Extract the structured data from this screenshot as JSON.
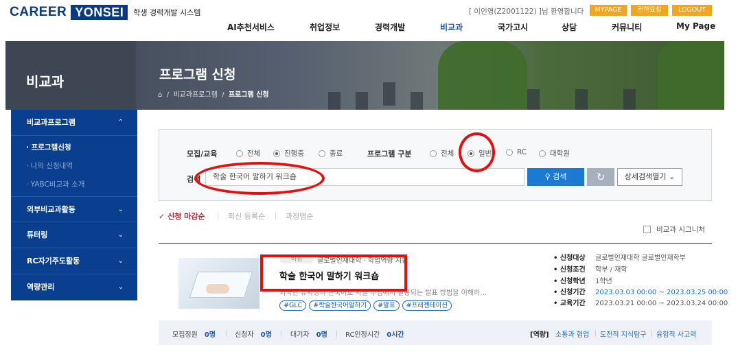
{
  "header": {
    "logo_career": "CAREER",
    "logo_yonsei": "YONSEI",
    "system_name": "학생 경력개발 시스템",
    "welcome": "[ 이인영(Z2001122) ]님 환영합니다",
    "top_buttons": [
      "MYPAGE",
      "권한요청",
      "LOGOUT"
    ],
    "nav": [
      "AI추천서비스",
      "취업정보",
      "경력개발",
      "비교과",
      "국가고시",
      "상담",
      "커뮤니티",
      "My Page"
    ],
    "active_nav": "비교과"
  },
  "banner": {
    "side_title": "비교과",
    "page_title": "프로그램 신청",
    "breadcrumb": [
      "비교과프로그램",
      "프로그램 신청"
    ]
  },
  "sidebar": {
    "groups": [
      {
        "label": "비교과프로그램",
        "chevron": "^"
      },
      {
        "label": "외부비교과활동",
        "chevron": "v"
      },
      {
        "label": "튜터링",
        "chevron": "v"
      },
      {
        "label": "RC자기주도활동",
        "chevron": "v"
      },
      {
        "label": "역량관리",
        "chevron": "v"
      }
    ],
    "subitems": [
      "· 프로그램신청",
      "· 나의 신청내역",
      "· YABC비교과 소개"
    ]
  },
  "search": {
    "recruit_label": "모집/교육",
    "recruit_options": [
      "전체",
      "진행중",
      "종료"
    ],
    "recruit_selected": "진행중",
    "type_label": "프로그램 구분",
    "type_options": [
      "전체",
      "일반",
      "RC",
      "대학원"
    ],
    "type_selected": "일반",
    "search_label": "검색",
    "search_value": "학술 한국어 말하기 워크숍",
    "search_button": "검색",
    "detail_button": "상세검색열기"
  },
  "sort": {
    "options": [
      "신청 마감순",
      "최신 등록순",
      "과정명순"
    ],
    "active": "신청 마감순",
    "signature_label": "비교과 시그니처"
  },
  "program": {
    "tag": "비임",
    "meta": "글로벌인재대학 · 학업역량 지원",
    "title": "학술 한국어 말하기 워크숍",
    "description": "외국인 유학생이 한국어로 학술 수업에서 활용되는 발표 방법을 이해하…",
    "hashtags": [
      "#GLC",
      "#학술한국어말하기",
      "#발표",
      "#프레젠테이션"
    ],
    "info": [
      {
        "k": "• 신청대상",
        "v": "글로벌인재대학  글로벌인재학부"
      },
      {
        "k": "• 신청조건",
        "v": "학부  /  재학"
      },
      {
        "k": "• 신청학년",
        "v": "1학년"
      },
      {
        "k": "• 신청기간",
        "v": "2023.03.03 00:00 ~ 2023.03.25 00:00"
      },
      {
        "k": "• 교육기간",
        "v": "2023.03.21 00:00 ~ 2023.03.24 00:00"
      }
    ],
    "stats": [
      {
        "k": "모집정원",
        "v": "0명"
      },
      {
        "k": "신청자",
        "v": "0명"
      },
      {
        "k": "대기자",
        "v": "0명"
      },
      {
        "k": "RC인정시간",
        "v": "0시간"
      }
    ],
    "competency_label": "[역량]",
    "competencies": [
      "소통과 협업",
      "도전적 지식탐구",
      "융합적 사고력"
    ]
  },
  "colors": {
    "brand": "#0a3a83",
    "accent": "#1b7bd4",
    "annotation": "#e40f0f",
    "button_orange": "#f2a51e"
  }
}
